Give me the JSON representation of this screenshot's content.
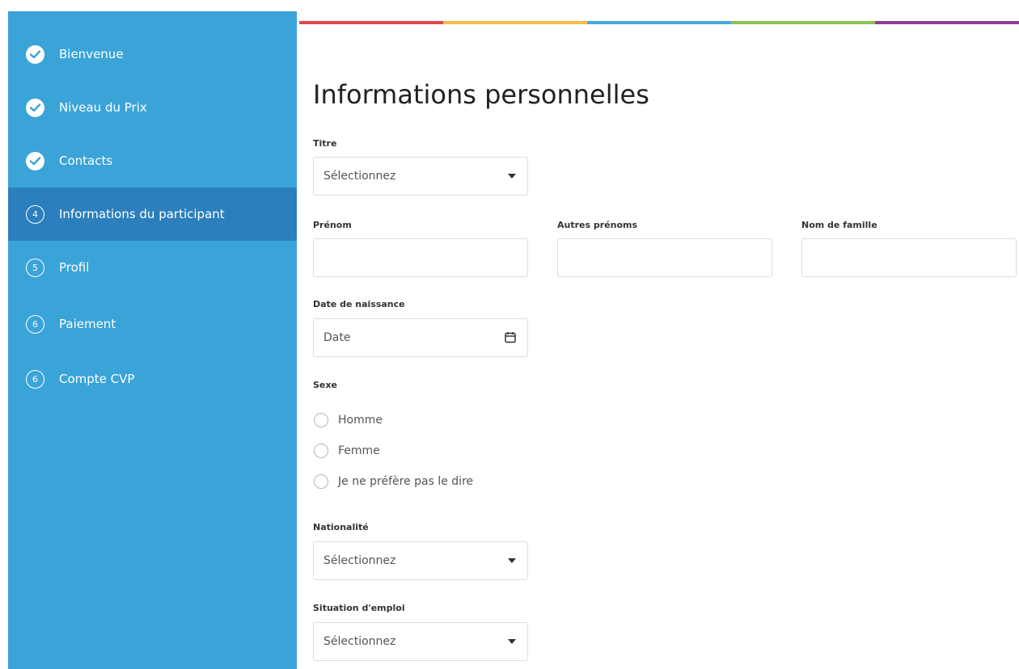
{
  "colors": {
    "sidebar_bg": "#3aa4d8",
    "sidebar_active_bg": "#2b7fbc",
    "rainbow": [
      "#e0474c",
      "#f5bd4a",
      "#4aa9df",
      "#8dc152",
      "#8e3d95"
    ]
  },
  "sidebar": {
    "items": [
      {
        "label": "Bienvenue",
        "status": "done",
        "icon": "check-icon"
      },
      {
        "label": "Niveau du Prix",
        "status": "done",
        "icon": "check-icon"
      },
      {
        "label": "Contacts",
        "status": "done",
        "icon": "check-icon"
      },
      {
        "label": "Informations du participant",
        "status": "active",
        "number": "4"
      },
      {
        "label": "Profil",
        "status": "pending",
        "number": "5"
      },
      {
        "label": "Paiement",
        "status": "pending",
        "number": "6"
      },
      {
        "label": "Compte CVP",
        "status": "pending",
        "number": "6"
      }
    ]
  },
  "form": {
    "title": "Informations personnelles",
    "titre": {
      "label": "Titre",
      "value": "Sélectionnez"
    },
    "prenom": {
      "label": "Prénom",
      "value": ""
    },
    "autres_prenoms": {
      "label": "Autres prénoms",
      "value": ""
    },
    "nom_de_famille": {
      "label": "Nom de famille",
      "value": ""
    },
    "date_naissance": {
      "label": "Date de naissance",
      "placeholder": "Date"
    },
    "sexe": {
      "label": "Sexe",
      "options": [
        "Homme",
        "Femme",
        "Je ne préfère pas le dire"
      ]
    },
    "nationalite": {
      "label": "Nationalité",
      "value": "Sélectionnez"
    },
    "situation_emploi": {
      "label": "Situation d'emploi",
      "value": "Sélectionnez"
    }
  }
}
